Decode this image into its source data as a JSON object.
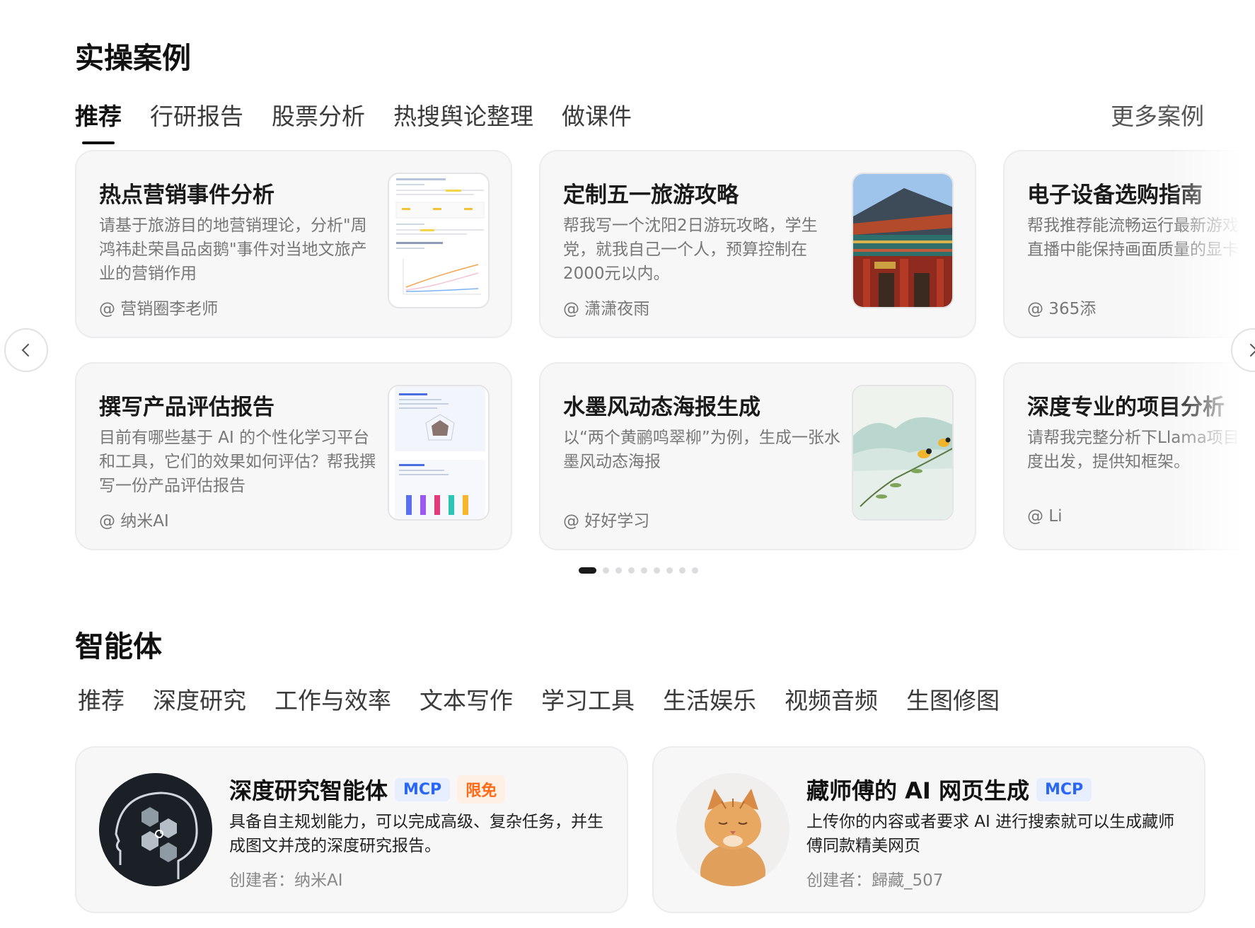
{
  "cases": {
    "title": "实操案例",
    "tabs": [
      "推荐",
      "行研报告",
      "股票分析",
      "热搜舆论整理",
      "做课件"
    ],
    "more": "更多案例",
    "cards": [
      {
        "title": "热点营销事件分析",
        "desc": "请基于旅游目的地营销理论，分析\"周鸿祎赴荣昌品卤鹅\"事件对当地文旅产业的营销作用",
        "author": "@ 营销圈李老师",
        "thumb": "document-icon"
      },
      {
        "title": "定制五一旅游攻略",
        "desc": "帮我写一个沈阳2日游玩攻略，学生党，就我自己一个人，预算控制在2000元以内。",
        "author": "@ 潇潇夜雨",
        "thumb": "temple-icon"
      },
      {
        "title": "电子设备选购指南",
        "desc": "帮我推荐能流畅运行最新游戏，并且在直播中能保持画面质量的显卡",
        "author": "@ 365添",
        "thumb": ""
      },
      {
        "title": "撰写产品评估报告",
        "desc": "目前有哪些基于 AI 的个性化学习平台和工具，它们的效果如何评估？帮我撰写一份产品评估报告",
        "author": "@ 纳米AI",
        "thumb": "report-icon"
      },
      {
        "title": "水墨风动态海报生成",
        "desc": "以“两个黄鹂鸣翠柳”为例，生成一张水墨风动态海报",
        "author": "@ 好好学习",
        "thumb": "ink-painting-icon"
      },
      {
        "title": "深度专业的项目分析",
        "desc": "请帮我完整分析下Llama项目，从多维度出发，提供知框架。",
        "author": "@ Li",
        "thumb": ""
      }
    ],
    "pagination": {
      "total": 9,
      "active": 0
    }
  },
  "agents": {
    "title": "智能体",
    "tabs": [
      "推荐",
      "深度研究",
      "工作与效率",
      "文本写作",
      "学习工具",
      "生活娱乐",
      "视频音频",
      "生图修图"
    ],
    "cards": [
      {
        "title": "深度研究智能体",
        "badges": [
          "MCP",
          "限免"
        ],
        "desc": "具备自主规划能力，可以完成高级、复杂任务，并生成图文并茂的深度研究报告。",
        "creator": "创建者：纳米AI",
        "avatar": "ai-head-icon"
      },
      {
        "title": "藏师傅的 AI 网页生成",
        "badges": [
          "MCP"
        ],
        "desc": "上传你的内容或者要求 AI 进行搜索就可以生成藏师傅同款精美网页",
        "creator": "创建者：歸藏_507",
        "avatar": "cat-avatar-icon"
      }
    ]
  },
  "colors": {
    "accent_blue": "#2966f5",
    "badge_orange": "#ff6a16",
    "card_bg": "#f7f7f8"
  }
}
